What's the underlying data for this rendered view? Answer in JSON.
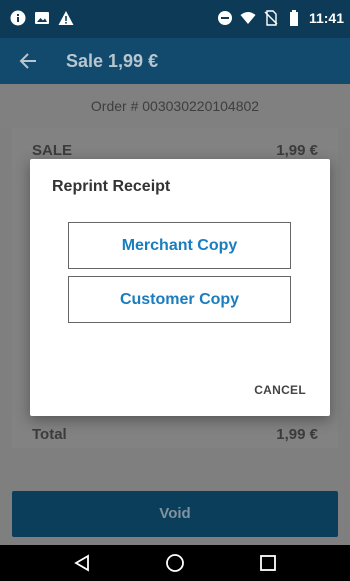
{
  "status_bar": {
    "time": "11:41",
    "left_icons": [
      "info-icon",
      "image-icon",
      "warning-icon"
    ],
    "right_icons": [
      "do-not-disturb-icon",
      "wifi-icon",
      "no-sim-icon",
      "battery-icon"
    ]
  },
  "app_bar": {
    "title": "Sale 1,99 €"
  },
  "order": {
    "label": "Order # 003030220104802"
  },
  "card": {
    "sale_label": "SALE",
    "sale_amount": "1,99 €",
    "total_label": "Total",
    "total_amount": "1,99 €"
  },
  "void_button": {
    "label": "Void"
  },
  "dialog": {
    "title": "Reprint Receipt",
    "merchant_copy": "Merchant Copy",
    "customer_copy": "Customer Copy",
    "cancel": "CANCEL"
  },
  "colors": {
    "status_bar": "#0c3a57",
    "app_bar": "#124a6e",
    "accent": "#1a7dbf",
    "overlay": "#7f7f7f"
  }
}
